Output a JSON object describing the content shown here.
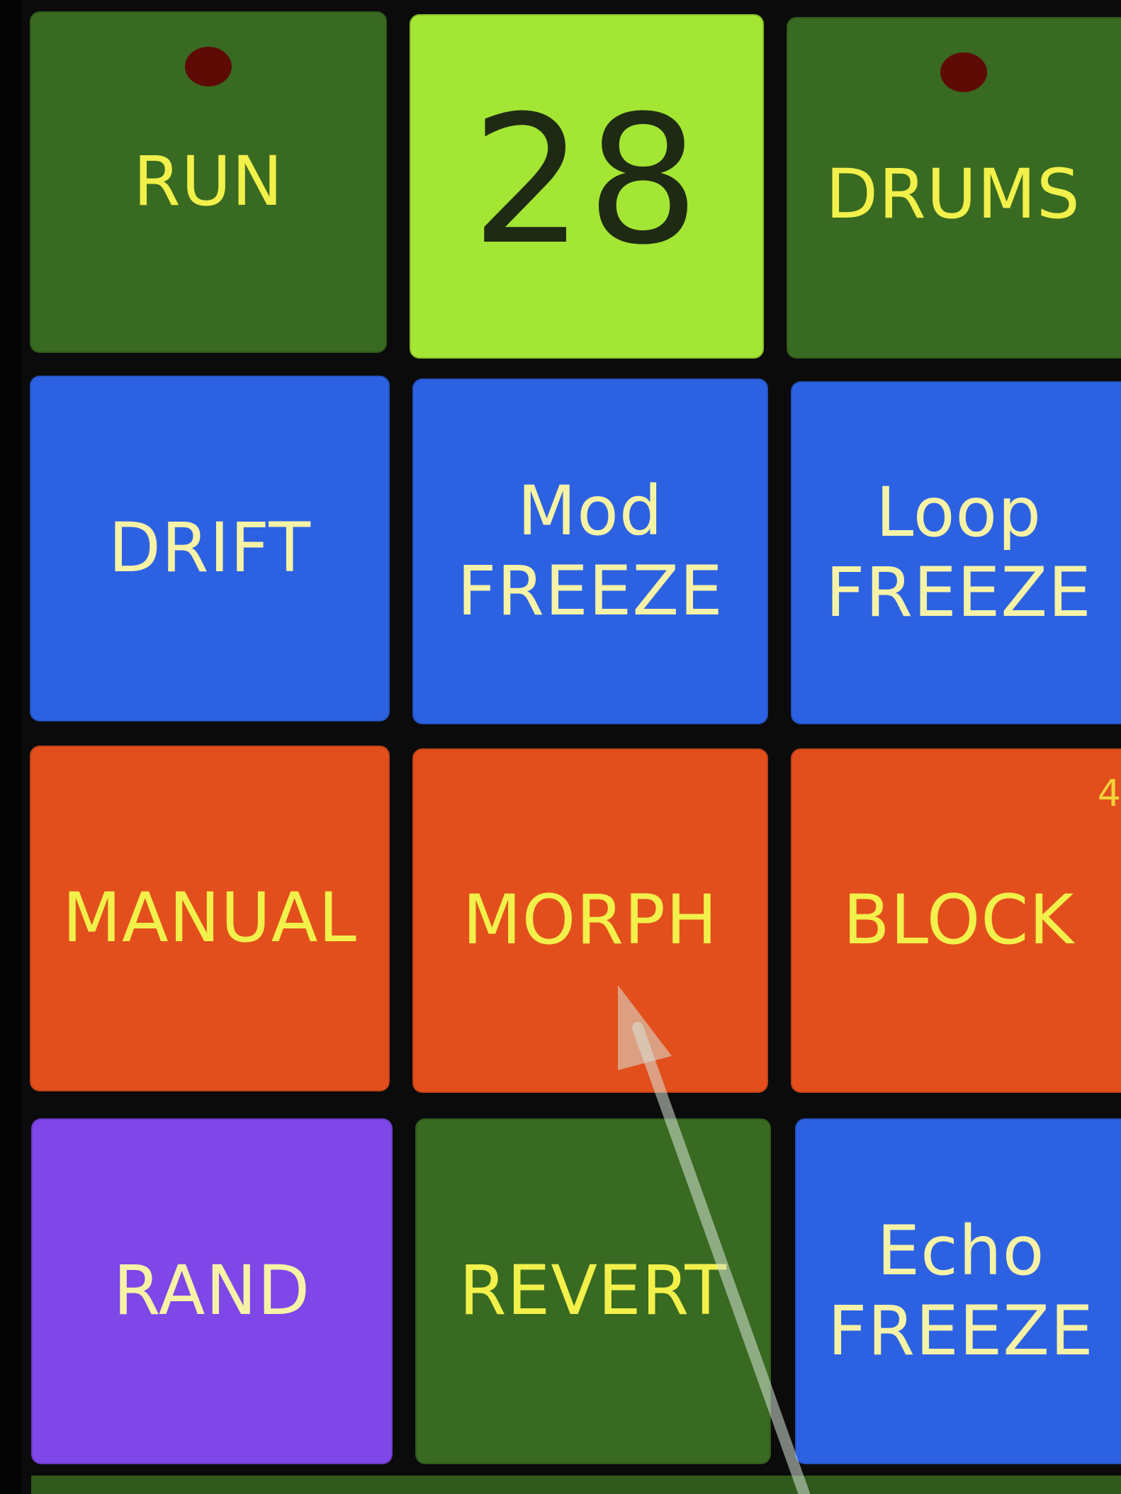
{
  "pads": {
    "run": {
      "label": "RUN"
    },
    "counter": {
      "value": "28"
    },
    "drums": {
      "label": "DRUMS"
    },
    "drift": {
      "label": "DRIFT"
    },
    "mod_freeze": {
      "line1": "Mod",
      "line2": "FREEZE"
    },
    "loop_freeze": {
      "line1": "Loop",
      "line2": "FREEZE"
    },
    "manual": {
      "label": "MANUAL"
    },
    "morph": {
      "label": "MORPH"
    },
    "block": {
      "label": "BLOCK"
    },
    "rand": {
      "label": "RAND"
    },
    "revert": {
      "label": "REVERT"
    },
    "echo_freeze": {
      "line1": "Echo",
      "line2": "FREEZE"
    }
  },
  "corner_number": "4",
  "colors": {
    "green": "#386a21",
    "lime": "#a3e634",
    "blue": "#2c62e2",
    "orange": "#e24f1c",
    "purple": "#7f46e8",
    "led": "#5e0b06",
    "label_yellow": "#f2f04a",
    "label_cream": "#f6f3a6"
  },
  "icons": {
    "run_led": "led-indicator-icon",
    "drums_led": "led-indicator-icon",
    "pointer": "arrow-pointer-icon"
  }
}
